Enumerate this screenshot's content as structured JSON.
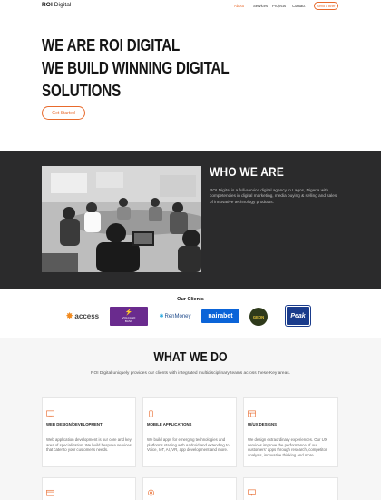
{
  "nav": {
    "logo_brand": "ROI",
    "logo_rest": " Digital",
    "links": [
      "About",
      "Services",
      "Projects",
      "Contact"
    ],
    "cta": "Send a Brief"
  },
  "hero": {
    "line1": "WE ARE ROI DIGITAL",
    "line2": "WE BUILD WINNING DIGITAL",
    "line3": "SOLUTIONS",
    "button": "Get Started"
  },
  "who": {
    "title": "WHO  WE ARE",
    "text": "ROI Digital is a full-service digital agency in Lagos, Nigeria with competencies in digital marketing, media buying & selling and sales of innovative technology products."
  },
  "clients": {
    "title": "Our Clients",
    "logos": {
      "access": "access",
      "volcano": "VOLCANO",
      "volcano_sub": "BANK",
      "renmoney": "RenMoney",
      "nairabet": "nairabet",
      "geon": "GEON",
      "peak": "Peak"
    }
  },
  "services": {
    "title": "WHAT WE DO",
    "subtitle": "ROI Digital uniquely provides our clients with integrated multidisciplinary teams across these Key areas.",
    "cards": [
      {
        "title": "WEB DESIGN/DEVELOPMENT",
        "text": "Web application development is our core and key area of specialization. We build bespoke services that cater to your customer's needs."
      },
      {
        "title": "MOBILE APPLICATIONS",
        "text": "We build apps for emerging technologies and platforms starting with Android and extending to Voice, IoT, AI, VR, app development and more."
      },
      {
        "title": "UI/UX DESIGNS",
        "text": "We design extraordinary experiences. Our UX services improve the performance of our customers' apps through research, competitor analysis, innovative thinking and more."
      }
    ]
  },
  "colors": {
    "accent": "#e86a2c",
    "dark_section": "#2b2b2c"
  }
}
